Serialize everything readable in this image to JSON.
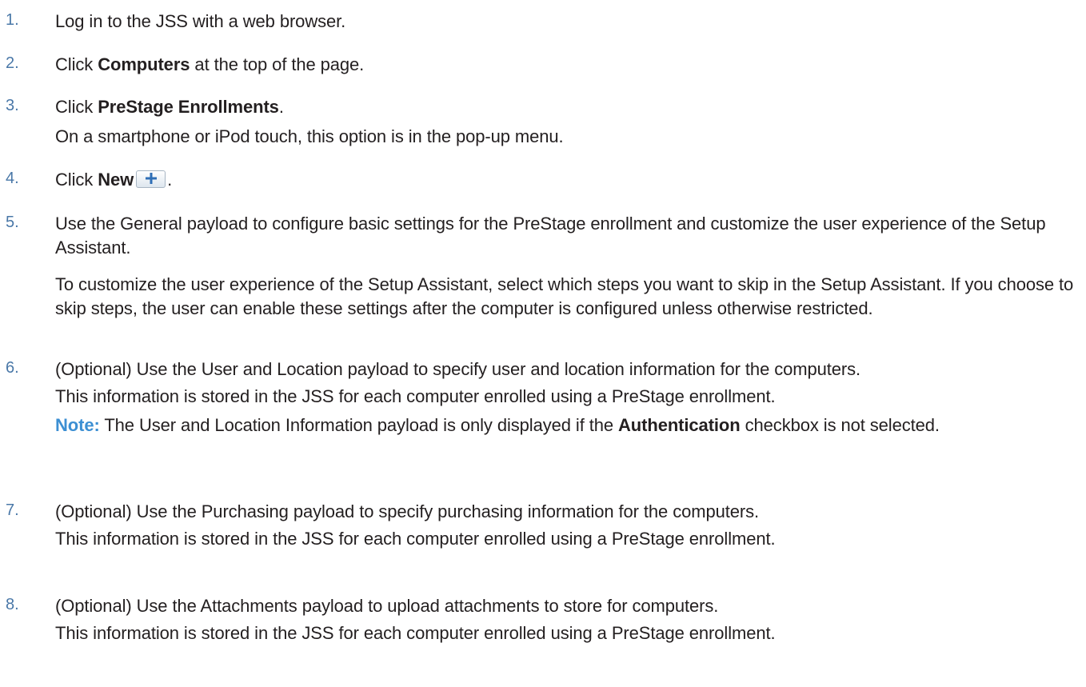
{
  "steps": [
    {
      "number": "1.",
      "text": "Log in to the JSS with a web browser."
    },
    {
      "number": "2.",
      "pre": "Click ",
      "bold": "Computers",
      "post": " at the top of the page."
    },
    {
      "number": "3.",
      "pre": "Click ",
      "bold": "PreStage Enrollments",
      "post": ".",
      "sub": "On a smartphone or iPod touch, this option is in the pop-up menu."
    },
    {
      "number": "4.",
      "pre": "Click ",
      "bold": "New",
      "post": "."
    },
    {
      "number": "5.",
      "text": "Use the General payload to configure basic settings for the PreStage enrollment and customize the user experience of the Setup Assistant.",
      "sub": "To customize the user experience of the Setup Assistant, select which steps you want to skip in the Setup Assistant. If you choose to skip steps, the user can enable these settings after the computer is configured unless otherwise restricted."
    },
    {
      "number": "6.",
      "text": "(Optional) Use the User and Location payload to specify user and location information for the computers.",
      "sub": "This information is stored in the JSS for each computer enrolled using a PreStage enrollment.",
      "note_label": "Note:",
      "note_pre": " The User and Location Information payload is only displayed if the ",
      "note_bold": "Authentication",
      "note_post": " checkbox is not selected."
    },
    {
      "number": "7.",
      "text": "(Optional) Use the Purchasing payload to specify purchasing information for the computers.",
      "sub": "This information is stored in the JSS for each computer enrolled using a PreStage enrollment."
    },
    {
      "number": "8.",
      "text": "(Optional) Use the Attachments payload to upload attachments to store for computers.",
      "sub": "This information is stored in the JSS for each computer enrolled using a PreStage enrollment."
    }
  ],
  "icons": {
    "new_button_icon": "plus-icon"
  },
  "colors": {
    "step_number": "#4a78a8",
    "note_label": "#3c8fd3",
    "text": "#231f20"
  }
}
